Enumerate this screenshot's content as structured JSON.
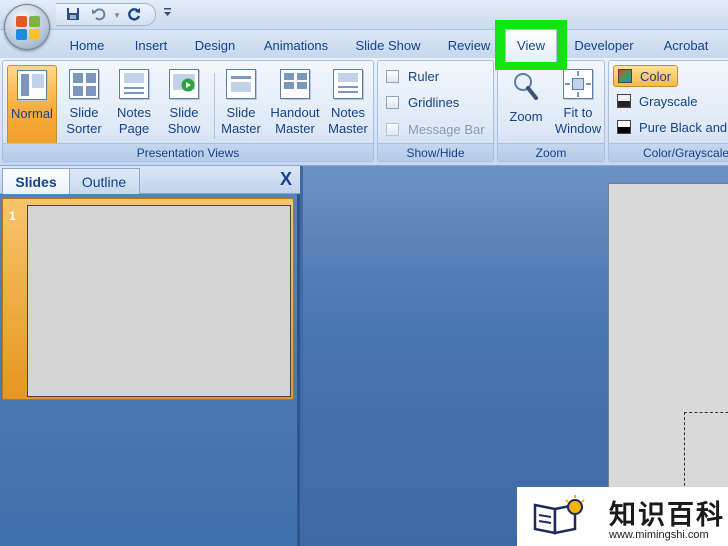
{
  "quick_access": {
    "save_icon": "floppy-disk-icon",
    "undo_icon": "undo-arrow-icon",
    "redo_icon": "redo-circle-icon"
  },
  "tabs": [
    {
      "label": "Home"
    },
    {
      "label": "Insert"
    },
    {
      "label": "Design"
    },
    {
      "label": "Animations"
    },
    {
      "label": "Slide Show"
    },
    {
      "label": "Review"
    },
    {
      "label": "View",
      "highlighted": true,
      "highlight_color": "#12e312"
    },
    {
      "label": "Developer"
    },
    {
      "label": "Acrobat"
    }
  ],
  "ribbon": {
    "presentation_views": {
      "label": "Presentation Views",
      "buttons": [
        {
          "label": "Normal",
          "active": true
        },
        {
          "label": "Slide Sorter"
        },
        {
          "label": "Notes Page"
        },
        {
          "label": "Slide Show"
        },
        {
          "label": "Slide Master"
        },
        {
          "label": "Handout Master"
        },
        {
          "label": "Notes Master"
        }
      ]
    },
    "show_hide": {
      "label": "Show/Hide",
      "items": [
        {
          "label": "Ruler",
          "checked": false
        },
        {
          "label": "Gridlines",
          "checked": false
        },
        {
          "label": "Message Bar",
          "checked": false,
          "disabled": true
        }
      ]
    },
    "zoom": {
      "label": "Zoom",
      "buttons": [
        {
          "label": "Zoom"
        },
        {
          "label": "Fit to Window"
        }
      ]
    },
    "color_grayscale": {
      "label": "Color/Grayscale",
      "items": [
        {
          "label": "Color",
          "active": true
        },
        {
          "label": "Grayscale"
        },
        {
          "label": "Pure Black and White"
        }
      ]
    }
  },
  "slides_pane": {
    "tabs": [
      {
        "label": "Slides",
        "active": true
      },
      {
        "label": "Outline"
      }
    ],
    "close_label": "X",
    "thumbnails": [
      {
        "number": "1"
      }
    ]
  },
  "watermark": {
    "title": "知识百科",
    "url": "www.mimingshi.com"
  },
  "colors": {
    "accent_orange": "#f8b042",
    "ribbon_text": "#15428b",
    "highlight_green": "#12e312"
  }
}
